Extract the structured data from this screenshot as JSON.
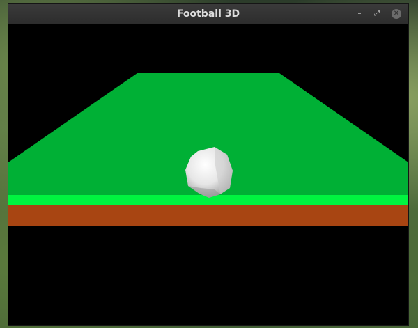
{
  "window": {
    "title": "Football 3D",
    "controls": {
      "minimize_glyph": "–",
      "maximize_glyph": "⤢",
      "close_glyph": "✕"
    }
  },
  "scene": {
    "background_color": "#000000",
    "pitch_color": "#00b035",
    "pitch_edge_color": "#00f440",
    "pitch_side_color": "#a84512",
    "ball_color": "#eaeaea"
  }
}
